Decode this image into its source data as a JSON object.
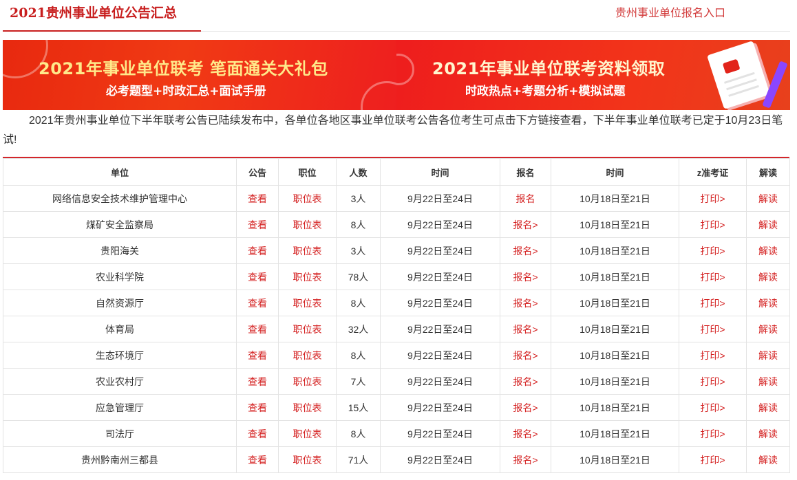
{
  "header": {
    "title": "2021贵州事业单位公告汇总",
    "register_link": "贵州事业单位报名入口"
  },
  "banners": [
    {
      "main": "2021年事业单位联考  笔面通关大礼包",
      "sub": "必考题型+时政汇总+面试手册"
    },
    {
      "main": "2021年事业单位联考资料领取",
      "sub": "时政热点+考题分析+模拟试题"
    }
  ],
  "intro": "2021年贵州事业单位下半年联考公告已陆续发布中，各单位各地区事业单位联考公告各位考生可点击下方链接查看，下半年事业单位联考已定于10月23日笔试!",
  "table": {
    "headers": [
      "单位",
      "公告",
      "职位",
      "人数",
      "时间",
      "报名",
      "时间",
      "z准考证",
      "解读"
    ],
    "rows": [
      {
        "unit": "网络信息安全技术维护管理中心",
        "notice": "查看",
        "positions": "职位表",
        "count": "3人",
        "reg_time": "9月22日至24日",
        "register": "报名",
        "exam_time": "10月18日至21日",
        "print": "打印>",
        "analysis": "解读"
      },
      {
        "unit": "煤矿安全监察局",
        "notice": "查看",
        "positions": "职位表",
        "count": "8人",
        "reg_time": "9月22日至24日",
        "register": "报名>",
        "exam_time": "10月18日至21日",
        "print": "打印>",
        "analysis": "解读"
      },
      {
        "unit": "贵阳海关",
        "notice": "查看",
        "positions": "职位表",
        "count": "3人",
        "reg_time": "9月22日至24日",
        "register": "报名>",
        "exam_time": "10月18日至21日",
        "print": "打印>",
        "analysis": "解读"
      },
      {
        "unit": "农业科学院",
        "notice": "查看",
        "positions": "职位表",
        "count": "78人",
        "reg_time": "9月22日至24日",
        "register": "报名>",
        "exam_time": "10月18日至21日",
        "print": "打印>",
        "analysis": "解读"
      },
      {
        "unit": "自然资源厅",
        "notice": "查看",
        "positions": "职位表",
        "count": "8人",
        "reg_time": "9月22日至24日",
        "register": "报名>",
        "exam_time": "10月18日至21日",
        "print": "打印>",
        "analysis": "解读"
      },
      {
        "unit": "体育局",
        "notice": "查看",
        "positions": "职位表",
        "count": "32人",
        "reg_time": "9月22日至24日",
        "register": "报名>",
        "exam_time": "10月18日至21日",
        "print": "打印>",
        "analysis": "解读"
      },
      {
        "unit": "生态环境厅",
        "notice": "查看",
        "positions": "职位表",
        "count": "8人",
        "reg_time": "9月22日至24日",
        "register": "报名>",
        "exam_time": "10月18日至21日",
        "print": "打印>",
        "analysis": "解读"
      },
      {
        "unit": "农业农村厅",
        "notice": "查看",
        "positions": "职位表",
        "count": "7人",
        "reg_time": "9月22日至24日",
        "register": "报名>",
        "exam_time": "10月18日至21日",
        "print": "打印>",
        "analysis": "解读"
      },
      {
        "unit": "应急管理厅",
        "notice": "查看",
        "positions": "职位表",
        "count": "15人",
        "reg_time": "9月22日至24日",
        "register": "报名>",
        "exam_time": "10月18日至21日",
        "print": "打印>",
        "analysis": "解读"
      },
      {
        "unit": "司法厅",
        "notice": "查看",
        "positions": "职位表",
        "count": "8人",
        "reg_time": "9月22日至24日",
        "register": "报名>",
        "exam_time": "10月18日至21日",
        "print": "打印>",
        "analysis": "解读"
      },
      {
        "unit": "贵州黔南州三都县",
        "notice": "查看",
        "positions": "职位表",
        "count": "71人",
        "reg_time": "9月22日至24日",
        "register": "报名>",
        "exam_time": "10月18日至21日",
        "print": "打印>",
        "analysis": "解读"
      }
    ]
  },
  "colors": {
    "accent": "#c81e1e",
    "link": "#d42020",
    "banner_bg": "#ee2a16",
    "banner_text": "#ffe98a"
  }
}
